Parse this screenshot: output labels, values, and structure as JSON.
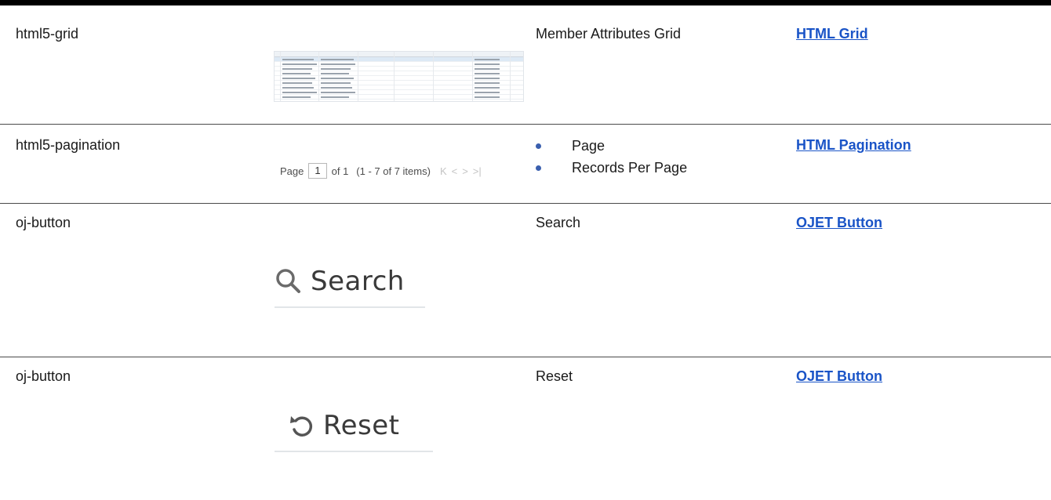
{
  "rows": [
    {
      "component": "html5-grid",
      "description": "Member Attributes Grid",
      "link": "HTML Grid"
    },
    {
      "component": "html5-pagination",
      "bullets": [
        "Page",
        "Records Per Page"
      ],
      "link": "HTML Pagination",
      "pager": {
        "page_label": "Page",
        "page_value": "1",
        "of_label": "of 1",
        "range_label": "(1 - 7 of  7  items)",
        "nav_first": "K",
        "nav_prev": "<",
        "nav_next": ">",
        "nav_last": ">|"
      }
    },
    {
      "component": "oj-button",
      "description": "Search",
      "link": "OJET Button",
      "button_label": "Search",
      "icon": "search-icon"
    },
    {
      "component": "oj-button",
      "description": "Reset",
      "link": "OJET Button",
      "button_label": "Reset",
      "icon": "reset-icon"
    }
  ],
  "colors": {
    "link": "#1a54c7",
    "bullet": "#3a5fae"
  }
}
